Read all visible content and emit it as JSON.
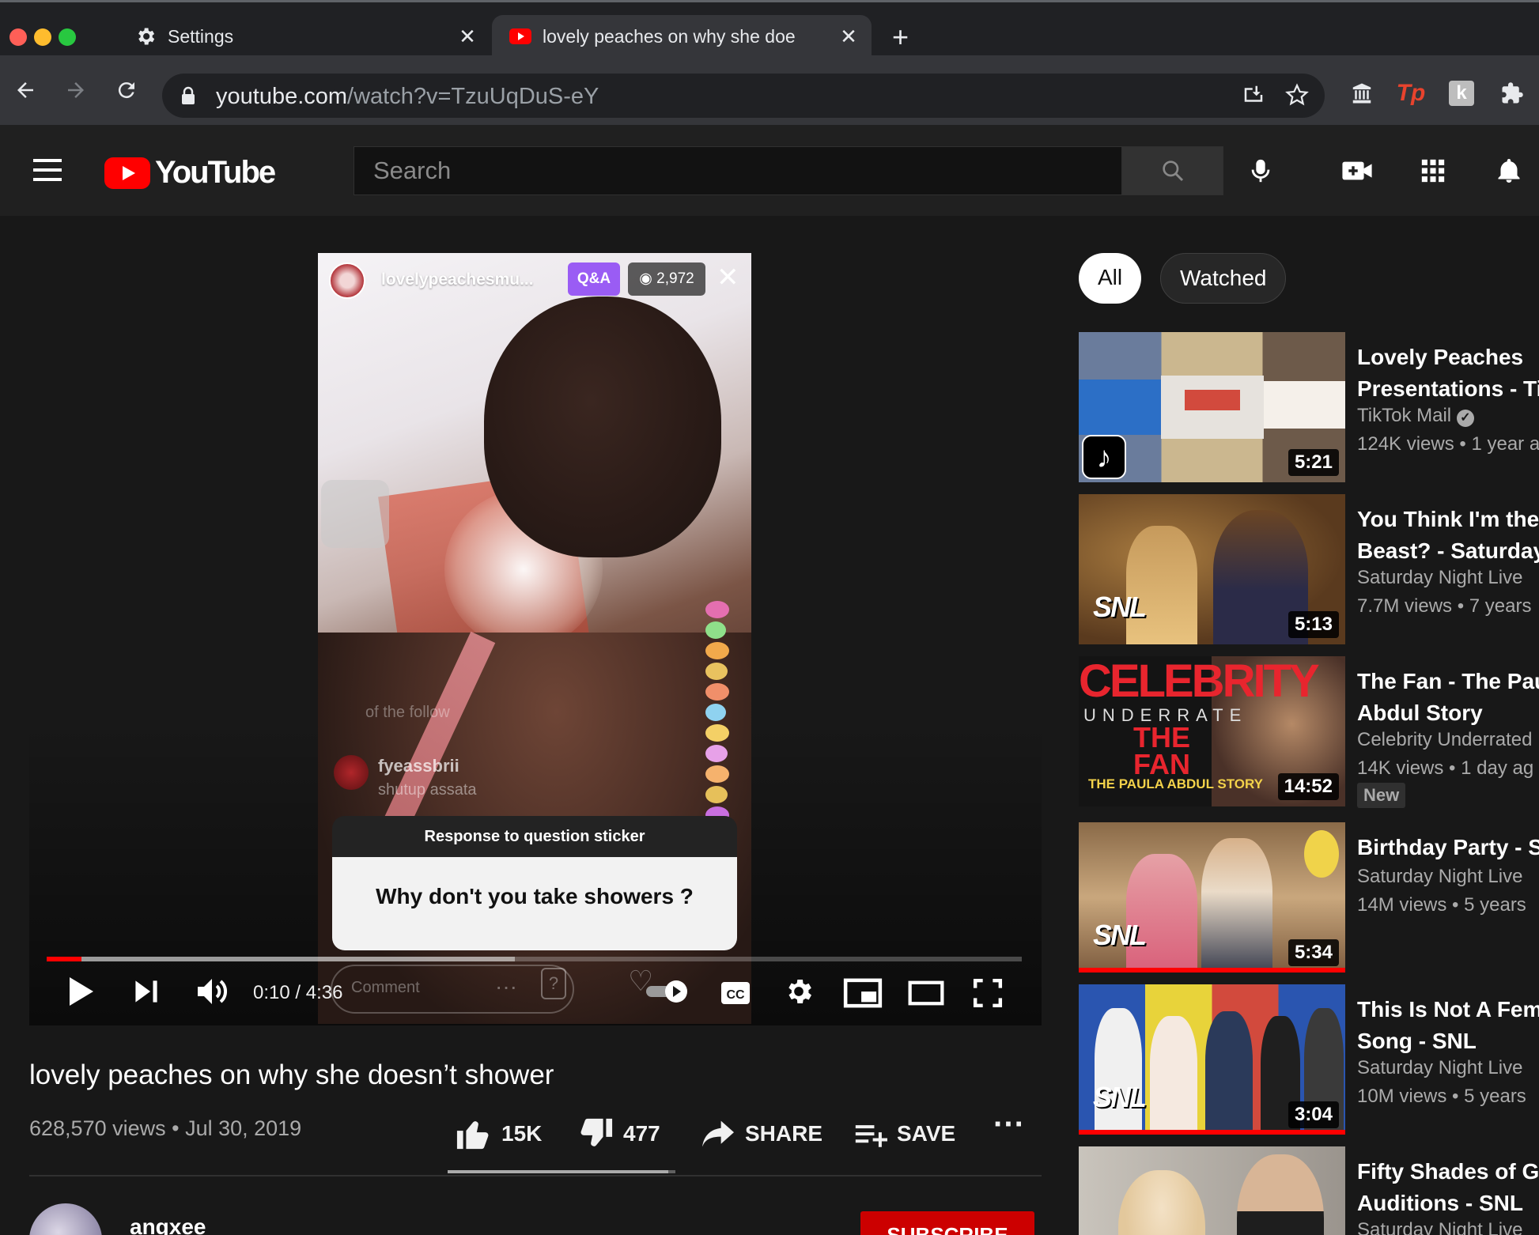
{
  "browser": {
    "tabs": [
      {
        "label": "Settings",
        "icon": "gear-icon"
      },
      {
        "label": "lovely peaches on why she doe",
        "icon": "youtube-favicon"
      }
    ],
    "url_host": "youtube.com",
    "url_path": "/watch?v=TzuUqDuS-eY"
  },
  "header": {
    "logo": "YouTube",
    "search_placeholder": "Search"
  },
  "player": {
    "ig_username": "lovelypeachesmu...",
    "ig_qa": "Q&A",
    "ig_viewers": "2,972",
    "ig_faint_comment": "of the follow",
    "ig_commenter": "fyeassbrii",
    "ig_comment": "shutup assata",
    "sticker_header": "Response to question sticker",
    "sticker_question": "Why don't you take showers ?",
    "ig_comment_placeholder": "Comment",
    "time_current": "0:10",
    "time_total": "4:36",
    "time_display": "0:10 / 4:36",
    "progress_fraction": 0.036,
    "buffered_fraction": 0.48
  },
  "video": {
    "title": "lovely peaches on why she doesn’t shower",
    "views": "628,570 views",
    "date": "Jul 30, 2019",
    "meta": "628,570 views • Jul 30, 2019",
    "likes": "15K",
    "dislikes": "477",
    "share_label": "SHARE",
    "save_label": "SAVE",
    "like_ratio": 0.97,
    "channel": "angxee",
    "subscribe_label": "SUBSCRIBE"
  },
  "filters": {
    "all": "All",
    "watched": "Watched"
  },
  "recommendations": [
    {
      "title1": "Lovely Peaches",
      "title2": "Presentations - Ti",
      "channel": "TikTok Mail",
      "verified": true,
      "stats": "124K views • 1 year a",
      "duration": "5:21"
    },
    {
      "title1": "You Think I'm the",
      "title2": "Beast? - Saturday",
      "channel": "Saturday Night Live",
      "stats": "7.7M views • 7 years",
      "duration": "5:13",
      "logo": "SNL"
    },
    {
      "title1": "The Fan - The Pau",
      "title2": "Abdul Story",
      "channel": "Celebrity Underrated",
      "stats": "14K views • 1 day ag",
      "badge": "New",
      "duration": "14:52",
      "thumb_title": "CELEBRITY",
      "thumb_sub": "UNDERRATE",
      "thumb_fan": "THE FAN",
      "thumb_story": "THE PAULA ABDUL STORY"
    },
    {
      "title1": "Birthday Party - SI",
      "title2": "",
      "channel": "Saturday Night Live",
      "stats": "14M views • 5 years",
      "duration": "5:34",
      "logo": "SNL"
    },
    {
      "title1": "This Is Not A Fem",
      "title2": "Song - SNL",
      "channel": "Saturday Night Live",
      "stats": "10M views • 5 years",
      "duration": "3:04",
      "logo": "SNL"
    },
    {
      "title1": "Fifty Shades of Gr",
      "title2": "Auditions - SNL",
      "channel": "Saturday Night Live",
      "stats": "",
      "duration": ""
    }
  ],
  "colors": {
    "brand": "#ff0000",
    "background": "#181818",
    "header": "#202020"
  }
}
